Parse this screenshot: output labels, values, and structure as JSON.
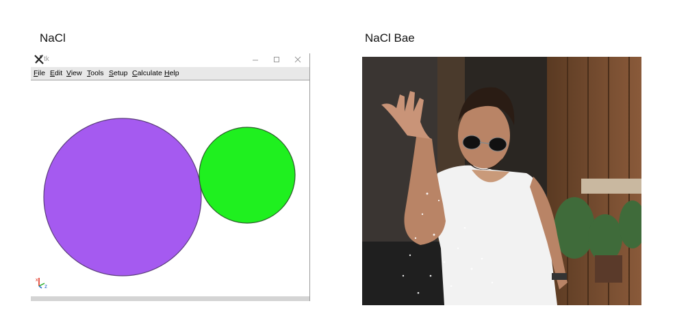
{
  "captions": {
    "left": "NaCl",
    "right": "NaCl Bae"
  },
  "window": {
    "title": "tk",
    "menu": [
      "File",
      "Edit",
      "View",
      "Tools",
      "Setup",
      "Calculate",
      "Help"
    ]
  },
  "canvas": {
    "circles": [
      {
        "name": "large-purple-circle",
        "color": "#a55af0"
      },
      {
        "name": "small-green-circle",
        "color": "#1ff01f"
      }
    ],
    "axes_icon": "xyz-axes-icon"
  },
  "photo": {
    "subject": "photo-salt-sprinkle"
  }
}
